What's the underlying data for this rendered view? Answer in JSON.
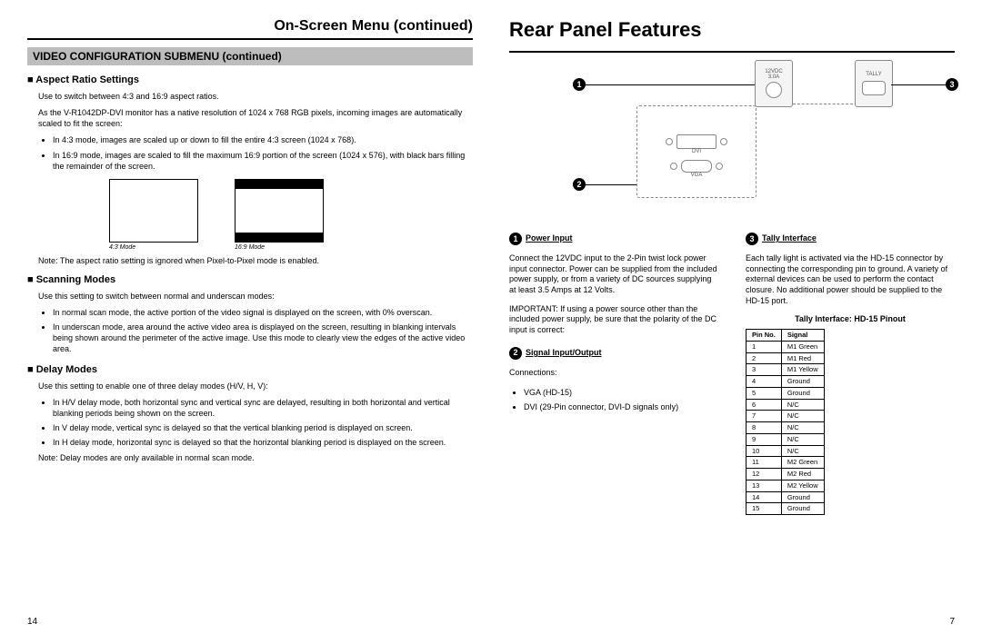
{
  "left": {
    "title": "On-Screen Menu (continued)",
    "submenu": "VIDEO CONFIGURATION SUBMENU (continued)",
    "aspect": {
      "heading": "Aspect Ratio Settings",
      "p1": "Use to switch between 4:3 and 16:9 aspect ratios.",
      "p2": "As the V-R1042DP-DVI monitor has a native resolution of 1024 x 768 RGB pixels, incoming images are automatically scaled to fit the screen:",
      "b1": "In 4:3 mode, images are scaled up or down to fill the entire 4:3 screen (1024 x 768).",
      "b2": "In 16:9 mode, images are scaled to fill the maximum 16:9 portion of the screen (1024 x 576), with black bars filling the remainder of the screen.",
      "cap43": "4:3 Mode",
      "cap169": "16:9 Mode",
      "note": "Note: The aspect ratio setting is ignored when Pixel-to-Pixel mode is enabled."
    },
    "scan": {
      "heading": "Scanning Modes",
      "p1": "Use this setting to switch between normal and underscan modes:",
      "b1": "In normal scan mode, the active portion of the video signal is displayed on the screen, with 0% overscan.",
      "b2": "In underscan mode, area around the active video area is displayed on the screen, resulting in blanking intervals being shown around the perimeter of the active image. Use this mode to clearly view the edges of the active video area."
    },
    "delay": {
      "heading": "Delay Modes",
      "p1": "Use this setting to enable one of three delay modes (H/V, H, V):",
      "b1": "In H/V delay mode, both horizontal sync and vertical sync are delayed, resulting in both horizontal and vertical blanking periods being shown on the screen.",
      "b2": "In V delay mode, vertical sync is delayed so that the vertical blanking period is displayed on screen.",
      "b3": "In H delay mode, horizontal sync is delayed so that the horizontal blanking period is displayed on the screen.",
      "note": "Note: Delay modes are only available in normal scan mode."
    },
    "pagenum": "14"
  },
  "right": {
    "title": "Rear Panel Features",
    "labels": {
      "dvi": "DVI",
      "vga": "VGA",
      "power": "12VDC\n3.0A",
      "tally": "TALLY"
    },
    "callouts": {
      "c1": "1",
      "c2": "2",
      "c3": "3"
    },
    "power": {
      "heading": "Power Input",
      "p1": "Connect the 12VDC input to the 2-Pin twist lock power input connector. Power can be supplied from the included power supply, or from a variety of DC sources supplying at least 3.5 Amps at 12 Volts.",
      "p2": "IMPORTANT: If using a power source other than the included power supply, be sure that the polarity of the DC input is correct:"
    },
    "sio": {
      "heading": "Signal Input/Output",
      "p1": "Connections:",
      "b1": "VGA (HD-15)",
      "b2": "DVI (29-Pin connector, DVI-D signals only)"
    },
    "tally": {
      "heading": "Tally Interface",
      "p1": "Each tally light is activated via the HD-15 connector by connecting the corresponding pin to ground. A variety of external devices can be used to perform the contact closure. No additional power should be supplied to the HD-15 port.",
      "tcaption": "Tally Interface: HD-15 Pinout",
      "th1": "Pin No.",
      "th2": "Signal",
      "rows": [
        [
          "1",
          "M1 Green"
        ],
        [
          "2",
          "M1 Red"
        ],
        [
          "3",
          "M1 Yellow"
        ],
        [
          "4",
          "Ground"
        ],
        [
          "5",
          "Ground"
        ],
        [
          "6",
          "N/C"
        ],
        [
          "7",
          "N/C"
        ],
        [
          "8",
          "N/C"
        ],
        [
          "9",
          "N/C"
        ],
        [
          "10",
          "N/C"
        ],
        [
          "11",
          "M2 Green"
        ],
        [
          "12",
          "M2 Red"
        ],
        [
          "13",
          "M2 Yellow"
        ],
        [
          "14",
          "Ground"
        ],
        [
          "15",
          "Ground"
        ]
      ]
    },
    "pagenum": "7"
  }
}
